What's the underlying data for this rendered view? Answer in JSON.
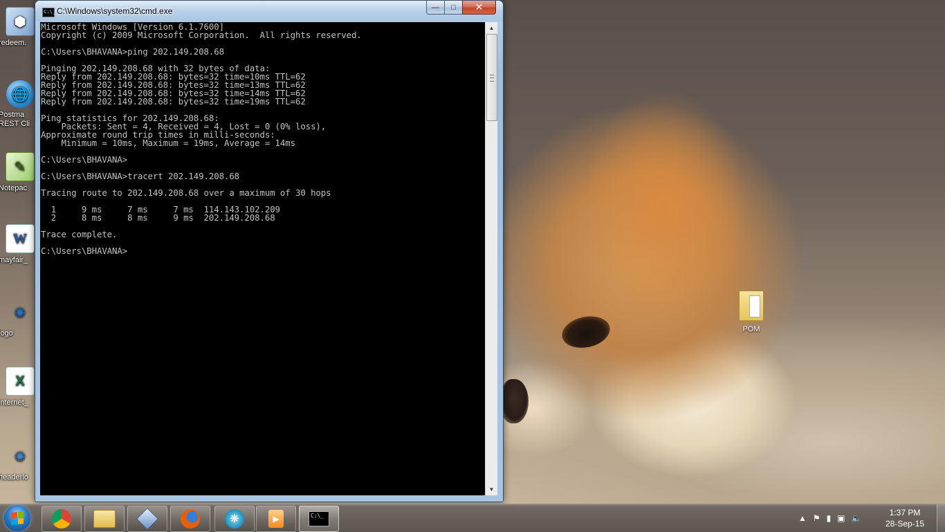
{
  "desktop": {
    "icons": [
      {
        "label": "redeem."
      },
      {
        "label": "Postma"
      },
      {
        "label": "REST Cli"
      },
      {
        "label": "Notepac"
      },
      {
        "label": "mayfair_"
      },
      {
        "label": "logo"
      },
      {
        "label": "internet_"
      },
      {
        "label": "headerlo"
      }
    ],
    "folder": {
      "label": "POM"
    }
  },
  "window": {
    "title": "C:\\Windows\\system32\\cmd.exe",
    "minimize": "—",
    "maximize": "□",
    "close": "✕",
    "console_icon": "C:\\_"
  },
  "console": {
    "lines": [
      "Microsoft Windows [Version 6.1.7600]",
      "Copyright (c) 2009 Microsoft Corporation.  All rights reserved.",
      "",
      "C:\\Users\\BHAVANA>ping 202.149.208.68",
      "",
      "Pinging 202.149.208.68 with 32 bytes of data:",
      "Reply from 202.149.208.68: bytes=32 time=10ms TTL=62",
      "Reply from 202.149.208.68: bytes=32 time=13ms TTL=62",
      "Reply from 202.149.208.68: bytes=32 time=14ms TTL=62",
      "Reply from 202.149.208.68: bytes=32 time=19ms TTL=62",
      "",
      "Ping statistics for 202.149.208.68:",
      "    Packets: Sent = 4, Received = 4, Lost = 0 (0% loss),",
      "Approximate round trip times in milli-seconds:",
      "    Minimum = 10ms, Maximum = 19ms, Average = 14ms",
      "",
      "C:\\Users\\BHAVANA>",
      "",
      "C:\\Users\\BHAVANA>tracert 202.149.208.68",
      "",
      "Tracing route to 202.149.208.68 over a maximum of 30 hops",
      "",
      "  1     9 ms     7 ms     7 ms  114.143.102.209",
      "  2     8 ms     8 ms     9 ms  202.149.208.68",
      "",
      "Trace complete.",
      "",
      "C:\\Users\\BHAVANA>"
    ]
  },
  "taskbar": {
    "apps": [
      {
        "name": "chrome",
        "color": "#db4437"
      },
      {
        "name": "file-explorer",
        "color": "#e9c46a"
      },
      {
        "name": "virtualbox",
        "color": "#6f93c9"
      },
      {
        "name": "firefox",
        "color": "#e66000"
      },
      {
        "name": "app-blue",
        "color": "#1e8fb8"
      },
      {
        "name": "media-player",
        "color": "#f28a20"
      },
      {
        "name": "cmd",
        "color": "#000000"
      }
    ],
    "clock": {
      "time": "1:37 PM",
      "date": "28-Sep-15"
    }
  }
}
